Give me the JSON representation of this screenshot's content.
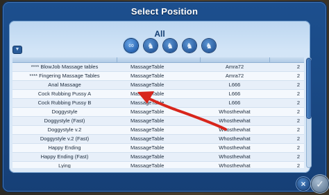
{
  "dialog": {
    "title": "Select Position",
    "category": "All",
    "filter_icons": [
      "infinity-icon",
      "pose-icon",
      "pose-icon",
      "pose-icon",
      "pose-icon"
    ]
  },
  "table": {
    "rows": [
      {
        "name": "**** BlowJob Massage tables",
        "object": "MassageTable",
        "creator": "Amra72",
        "count": "2"
      },
      {
        "name": "**** Fingering Massage Tables",
        "object": "MassageTable",
        "creator": "Amra72",
        "count": "2"
      },
      {
        "name": "Anal Massage",
        "object": "MassageTable",
        "creator": "L666",
        "count": "2"
      },
      {
        "name": "Cock Rubbing Pussy A",
        "object": "MassageTable",
        "creator": "L666",
        "count": "2"
      },
      {
        "name": "Cock Rubbing Pussy B",
        "object": "MassageTable",
        "creator": "L666",
        "count": "2"
      },
      {
        "name": "Doggystyle",
        "object": "MassageTable",
        "creator": "Whosthewhat",
        "count": "2"
      },
      {
        "name": "Doggystyle (Fast)",
        "object": "MassageTable",
        "creator": "Whosthewhat",
        "count": "2"
      },
      {
        "name": "Doggystyle v.2",
        "object": "MassageTable",
        "creator": "Whosthewhat",
        "count": "2"
      },
      {
        "name": "Doggystyle v.2 (Fast)",
        "object": "MassageTable",
        "creator": "Whosthewhat",
        "count": "2"
      },
      {
        "name": "Happy Ending",
        "object": "MassageTable",
        "creator": "Whosthewhat",
        "count": "2"
      },
      {
        "name": "Happy Ending (Fast)",
        "object": "MassageTable",
        "creator": "Whosthewhat",
        "count": "2"
      },
      {
        "name": "Lying",
        "object": "MassageTable",
        "creator": "Whosthewhat",
        "count": "2"
      }
    ]
  },
  "colors": {
    "window": "#1a4a86",
    "panel": "#dce9f7",
    "annotation_arrow": "#d8261c"
  }
}
